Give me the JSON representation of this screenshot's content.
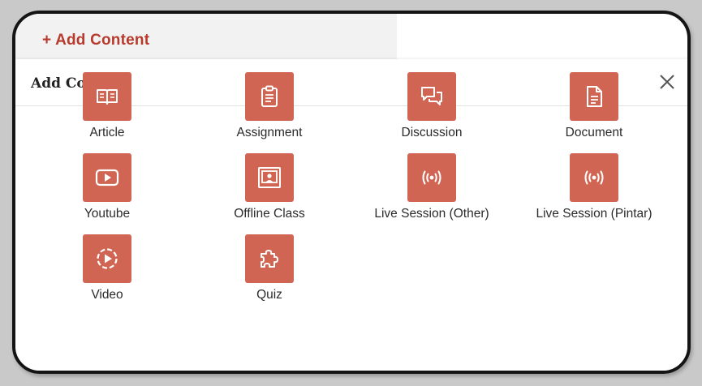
{
  "header": {
    "add_content_link": "+ Add Content"
  },
  "modal": {
    "title": "Add Content",
    "close_icon": "close-icon"
  },
  "colors": {
    "accent": "#b73a2c",
    "tile": "#d06553"
  },
  "items": [
    {
      "label": "Article",
      "icon": "book-open-icon"
    },
    {
      "label": "Assignment",
      "icon": "clipboard-icon"
    },
    {
      "label": "Discussion",
      "icon": "chat-bubbles-icon"
    },
    {
      "label": "Document",
      "icon": "document-icon"
    },
    {
      "label": "Youtube",
      "icon": "youtube-play-icon"
    },
    {
      "label": "Offline Class",
      "icon": "presentation-board-icon"
    },
    {
      "label": "Live Session (Other)",
      "icon": "broadcast-icon"
    },
    {
      "label": "Live Session (Pintar)",
      "icon": "broadcast-icon"
    },
    {
      "label": "Video",
      "icon": "video-play-icon"
    },
    {
      "label": "Quiz",
      "icon": "puzzle-icon"
    }
  ]
}
